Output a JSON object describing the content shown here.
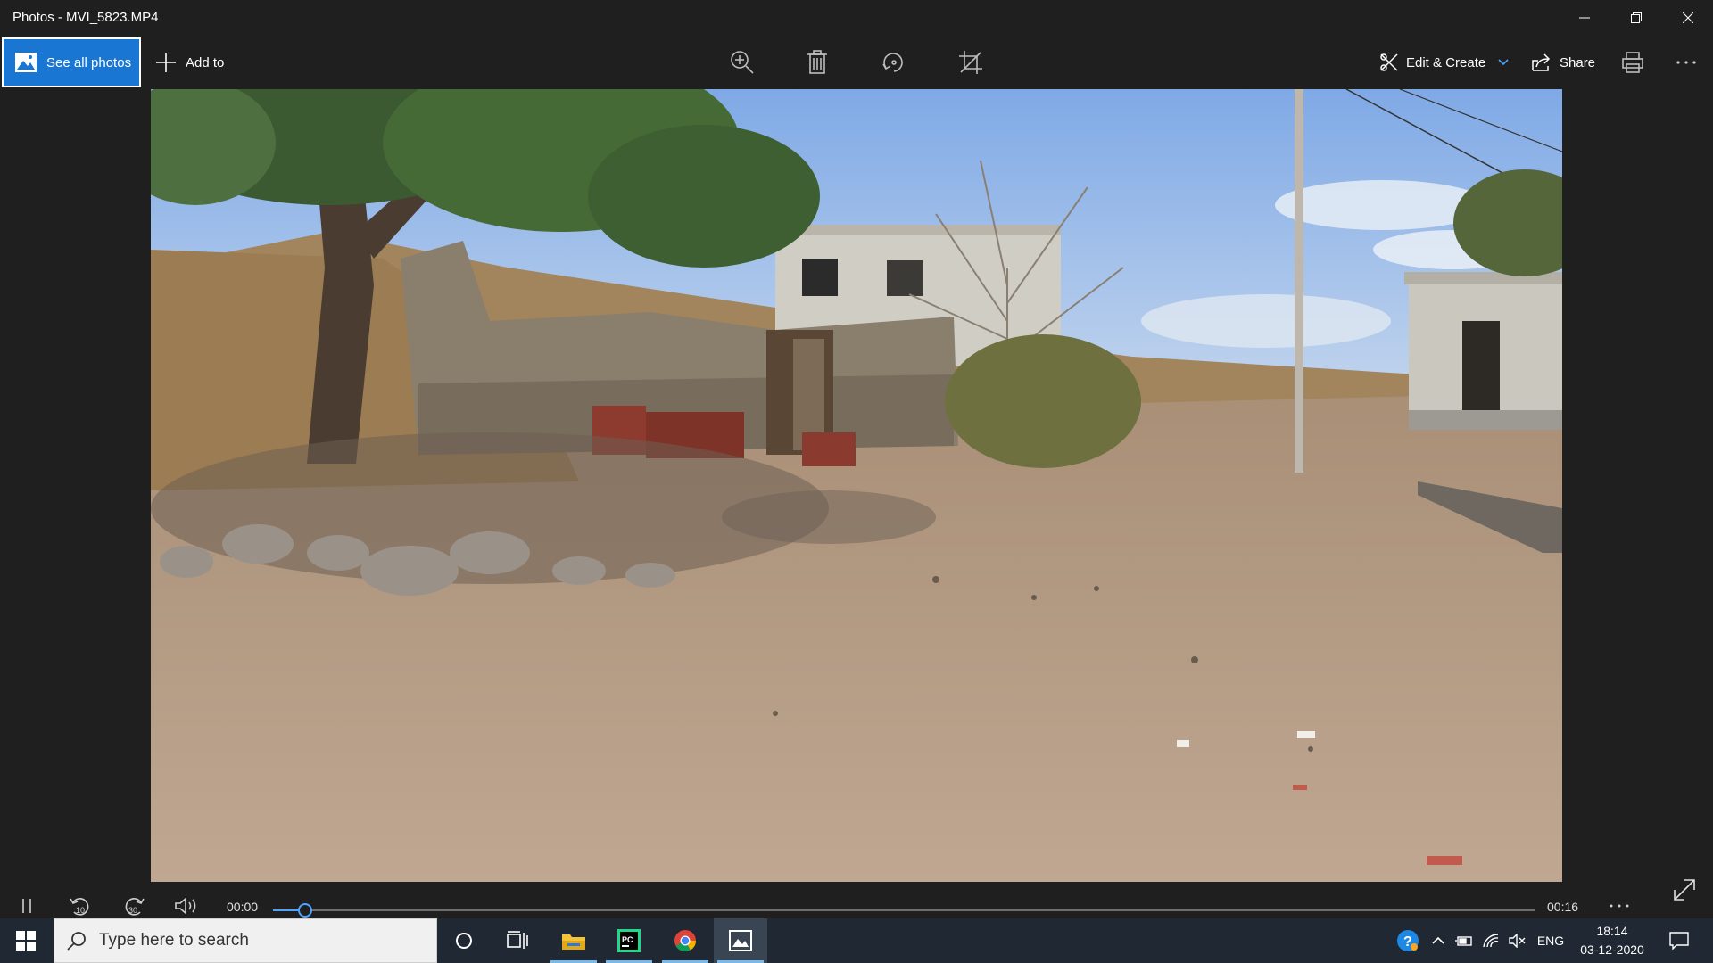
{
  "window": {
    "title": "Photos - MVI_5823.MP4"
  },
  "toolbar": {
    "see_all_label": "See all photos",
    "add_to_label": "Add to",
    "edit_create_label": "Edit & Create",
    "share_label": "Share",
    "icons": [
      "zoom-icon",
      "delete-icon",
      "rotate-icon",
      "crop-icon",
      "print-icon",
      "more-icon"
    ]
  },
  "player": {
    "current_time": "00:00",
    "duration": "00:16",
    "progress_fraction": 0.02,
    "accent": "#4fa3ff",
    "skip_back_label": "10",
    "skip_forward_label": "30"
  },
  "taskbar": {
    "search_placeholder": "Type here to search",
    "language": "ENG",
    "time": "18:14",
    "date": "03-12-2020",
    "apps": [
      "cortana",
      "task-view",
      "file-explorer",
      "pycharm",
      "chrome",
      "photos"
    ]
  },
  "colors": {
    "accent_blue": "#1976d2",
    "taskbar": "#202833",
    "app_bg": "#1f1f1f"
  }
}
